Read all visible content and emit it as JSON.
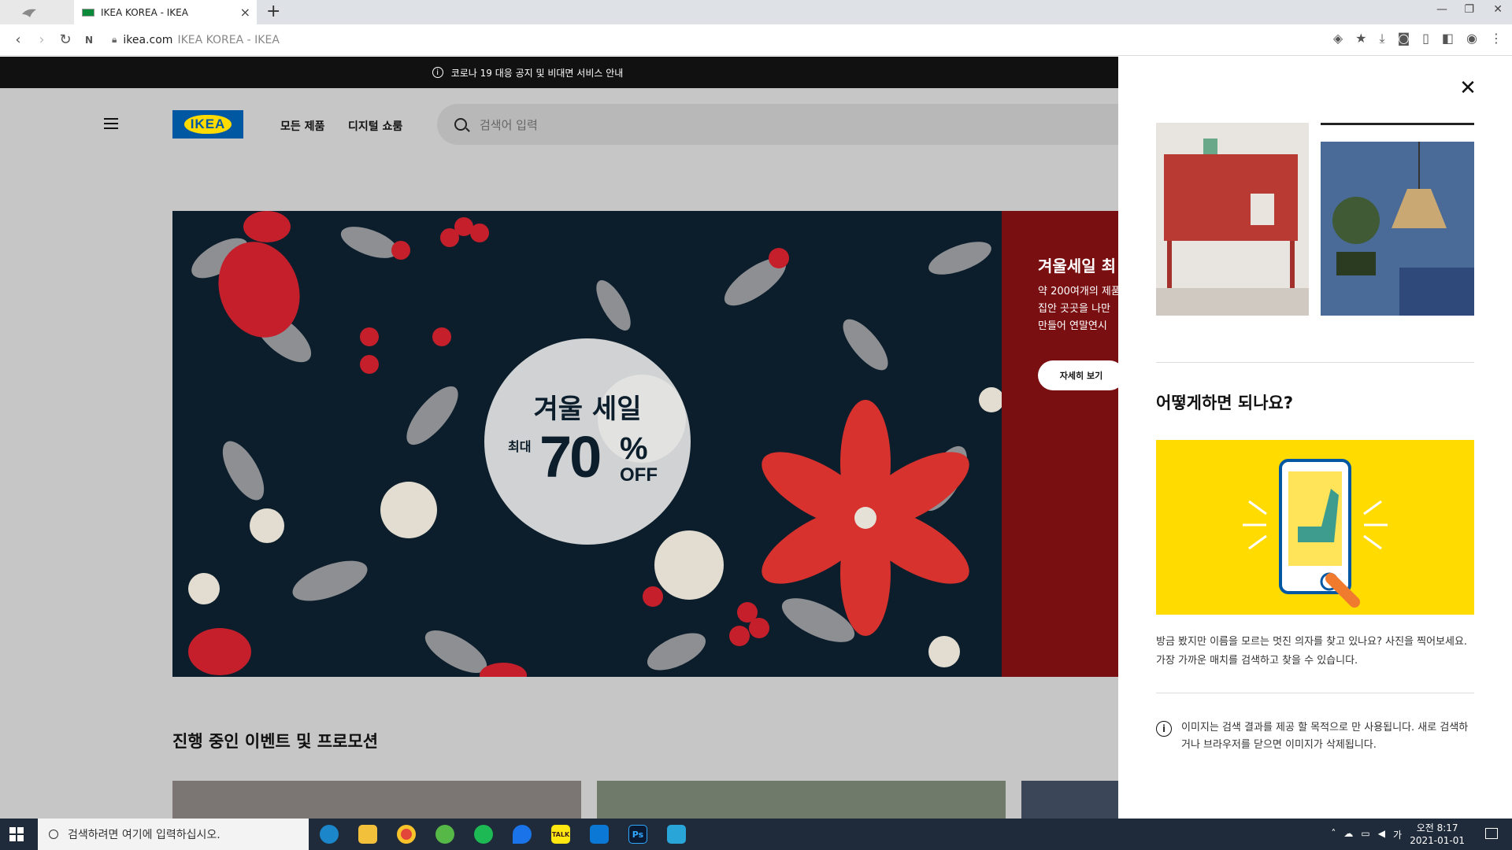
{
  "browser": {
    "tab_title": "IKEA KOREA - IKEA",
    "new_tab": "+",
    "url_domain": "ikea.com",
    "url_title": "IKEA KOREA - IKEA"
  },
  "notice": {
    "text": "코로나 19 대응 공지 및 비대면 서비스 안내"
  },
  "header": {
    "logo": "IKEA",
    "nav": [
      "모든 제품",
      "디지털 쇼룸"
    ],
    "search_placeholder": "검색어 입력"
  },
  "hero": {
    "circle_title": "겨울 세일",
    "circle_prefix": "최대",
    "circle_number": "70",
    "circle_percent": "%",
    "circle_off": "OFF",
    "side_title": "겨울세일 최",
    "side_lines": [
      "약 200여개의 제품",
      "집안 곳곳을 나만",
      "만들어 연말연시"
    ],
    "side_button": "자세히 보기"
  },
  "section": {
    "title": "진행 중인 이벤트 및 프로모션"
  },
  "panel": {
    "close": "✕",
    "heading": "어떻게하면 되나요?",
    "description": "방금 봤지만 이름을 모르는 멋진 의자를 찾고 있나요? 사진을 찍어보세요. 가장 가까운 매치를 검색하고 찾을 수 있습니다.",
    "note": "이미지는 검색 결과를 제공 할 목적으로 만 사용됩니다. 새로 검색하거나 브라우저를 닫으면 이미지가 삭제됩니다."
  },
  "taskbar": {
    "search_placeholder": "검색하려면 여기에 입력하십시오.",
    "ime": "가",
    "time": "오전 8:17",
    "date": "2021-01-01",
    "apps": [
      "edge",
      "file-explorer",
      "chrome",
      "utorrent",
      "spotify",
      "maps",
      "kakaotalk",
      "vscode",
      "photoshop",
      "browser"
    ],
    "kakao_label": "TALK",
    "ps_label": "Ps"
  },
  "colors": {
    "ikea_blue": "#0058a3",
    "ikea_yellow": "#ffdb00",
    "hero_red": "#7a0f12",
    "hero_navy": "#0c1e2c"
  }
}
